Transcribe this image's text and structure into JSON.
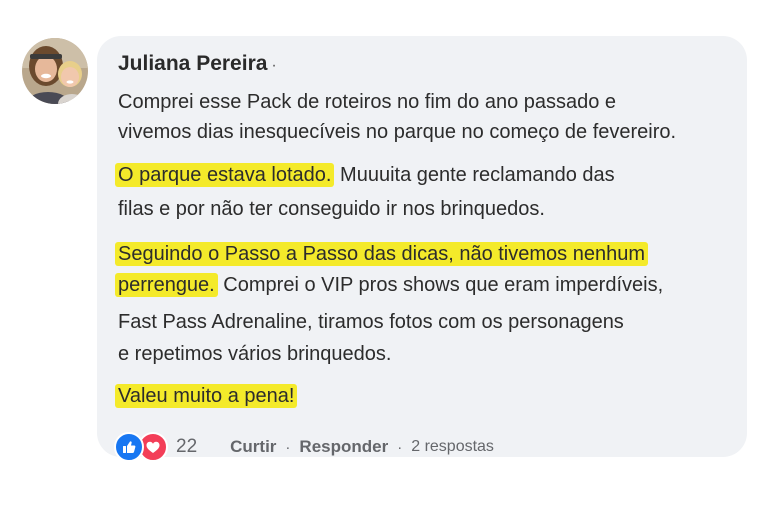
{
  "comment": {
    "author": "Juliana Pereira",
    "author_separator": "·",
    "lines": [
      {
        "normal": "Comprei esse Pack de roteiros no fim do ano passado e"
      },
      {
        "normal": "vivemos dias inesquecíveis no parque no começo de fevereiro."
      },
      {
        "highlight": "O parque estava lotado.",
        "normal": " Muuuita gente reclamando das"
      },
      {
        "normal": "filas e por não ter conseguido ir nos brinquedos."
      },
      {
        "highlight": "Seguindo o Passo a Passo das dicas, não tivemos nenhum"
      },
      {
        "highlight": "perrengue.",
        "normal": " Comprei o VIP pros shows que eram imperdíveis,"
      },
      {
        "normal": "Fast Pass Adrenaline, tiramos fotos com os personagens"
      },
      {
        "normal": "e repetimos vários brinquedos."
      },
      {
        "highlight": "Valeu muito a pena!"
      }
    ],
    "highlight_color": "#f4ea2a"
  },
  "footer": {
    "reactions": [
      "like-icon",
      "love-icon"
    ],
    "reaction_count": "22",
    "like_action": "Curtir",
    "reply_action": "Responder",
    "separator": "·",
    "replies": "2 respostas"
  },
  "colors": {
    "bubble": "#f0f2f5",
    "like": "#1877f2",
    "love": "#f33e58",
    "meta_text": "#65676b"
  }
}
